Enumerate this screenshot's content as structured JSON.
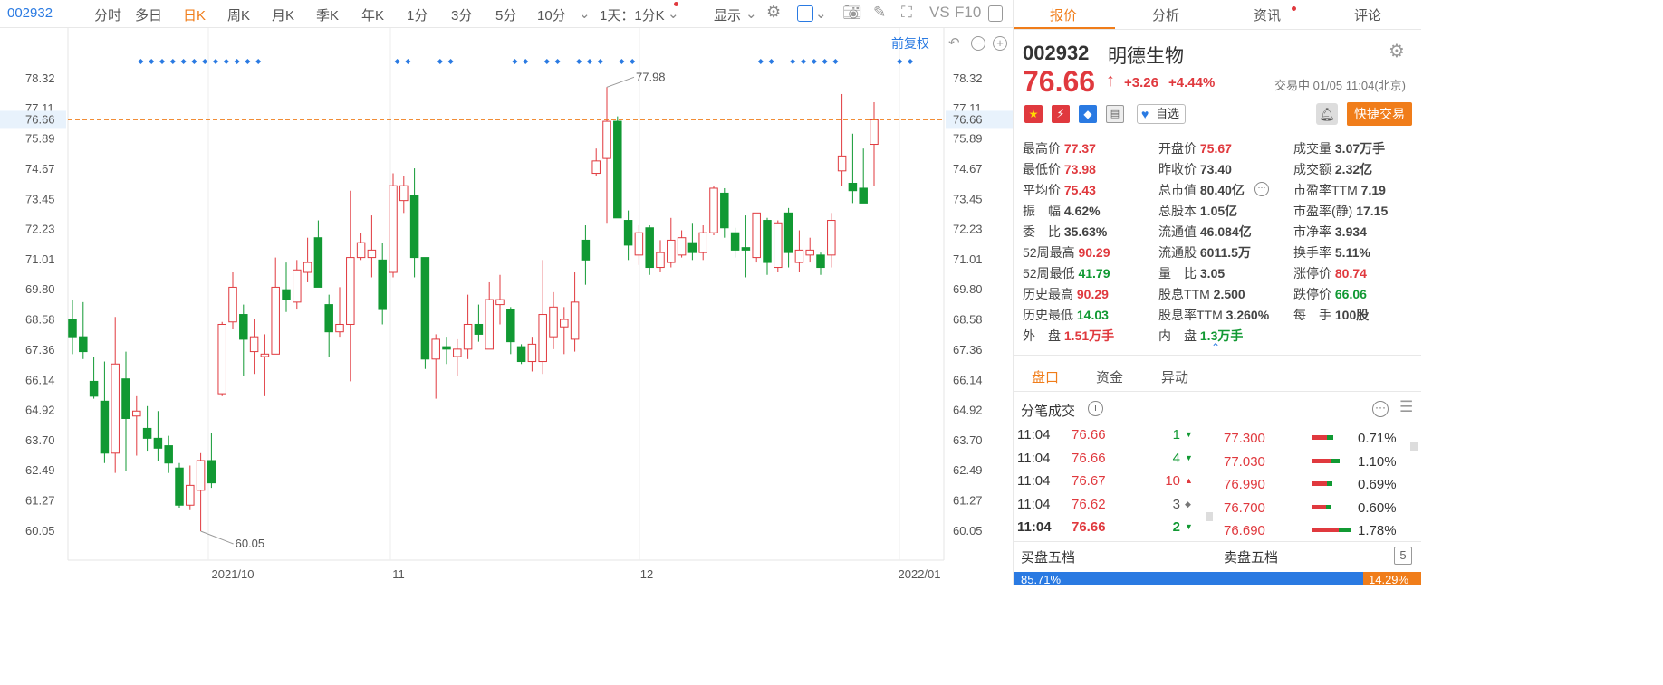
{
  "toolbar": {
    "code": "002932",
    "items": [
      "分时",
      "多日",
      "日K",
      "周K",
      "月K",
      "季K",
      "年K",
      "1分",
      "3分",
      "5分",
      "10分"
    ],
    "active": "日K",
    "range": "1天：1分K",
    "display": "显示",
    "vs": "VS",
    "f10": "F10"
  },
  "chart_header": {
    "adjust": "前复权"
  },
  "chart_data": {
    "type": "candlestick",
    "y_ticks": [
      "78.32",
      "77.11",
      "76.66",
      "75.89",
      "74.67",
      "73.45",
      "72.23",
      "71.01",
      "69.80",
      "68.58",
      "67.36",
      "66.14",
      "64.92",
      "63.70",
      "62.49",
      "61.27",
      "60.05"
    ],
    "ylim": [
      60.05,
      78.32
    ],
    "x_ticks": [
      "2021/10",
      "11",
      "12",
      "2022/01"
    ],
    "current_price": 76.66,
    "max_label": "77.98",
    "min_label": "60.05",
    "candles": [
      {
        "o": 68.6,
        "c": 67.9,
        "h": 69.4,
        "l": 67.2
      },
      {
        "o": 67.9,
        "c": 67.3,
        "h": 69.3,
        "l": 67.0
      },
      {
        "o": 66.1,
        "c": 65.5,
        "h": 67.1,
        "l": 65.4
      },
      {
        "o": 65.3,
        "c": 63.2,
        "h": 66.9,
        "l": 62.8
      },
      {
        "o": 63.2,
        "c": 66.8,
        "h": 68.7,
        "l": 62.4
      },
      {
        "o": 66.2,
        "c": 64.6,
        "h": 67.3,
        "l": 62.5
      },
      {
        "o": 64.7,
        "c": 64.9,
        "h": 65.5,
        "l": 63.1
      },
      {
        "o": 64.2,
        "c": 63.8,
        "h": 65.1,
        "l": 63.3
      },
      {
        "o": 63.8,
        "c": 63.4,
        "h": 64.9,
        "l": 62.9
      },
      {
        "o": 63.5,
        "c": 62.8,
        "h": 63.9,
        "l": 62.4
      },
      {
        "o": 62.6,
        "c": 61.1,
        "h": 62.8,
        "l": 61.0
      },
      {
        "o": 61.1,
        "c": 61.9,
        "h": 62.7,
        "l": 60.9
      },
      {
        "o": 61.7,
        "c": 62.9,
        "h": 63.2,
        "l": 60.05
      },
      {
        "o": 62.9,
        "c": 62.0,
        "h": 64.0,
        "l": 61.8
      },
      {
        "o": 65.6,
        "c": 68.4,
        "h": 68.5,
        "l": 65.5
      },
      {
        "o": 68.5,
        "c": 69.9,
        "h": 70.5,
        "l": 68.2
      },
      {
        "o": 68.8,
        "c": 67.8,
        "h": 69.2,
        "l": 66.3
      },
      {
        "o": 67.3,
        "c": 67.9,
        "h": 68.6,
        "l": 66.4
      },
      {
        "o": 67.1,
        "c": 67.2,
        "h": 68.0,
        "l": 65.5
      },
      {
        "o": 67.2,
        "c": 69.9,
        "h": 71.1,
        "l": 67.2
      },
      {
        "o": 69.8,
        "c": 69.4,
        "h": 70.9,
        "l": 68.9
      },
      {
        "o": 69.3,
        "c": 70.6,
        "h": 71.0,
        "l": 69.0
      },
      {
        "o": 70.5,
        "c": 70.9,
        "h": 71.9,
        "l": 70.1
      },
      {
        "o": 71.9,
        "c": 69.9,
        "h": 72.6,
        "l": 69.9
      },
      {
        "o": 69.2,
        "c": 68.1,
        "h": 69.6,
        "l": 67.1
      },
      {
        "o": 68.1,
        "c": 68.4,
        "h": 69.9,
        "l": 67.9
      },
      {
        "o": 68.4,
        "c": 71.1,
        "h": 73.8,
        "l": 66.1
      },
      {
        "o": 71.1,
        "c": 71.7,
        "h": 72.1,
        "l": 71.0
      },
      {
        "o": 71.1,
        "c": 71.4,
        "h": 72.8,
        "l": 70.3
      },
      {
        "o": 71.0,
        "c": 69.0,
        "h": 71.7,
        "l": 68.4
      },
      {
        "o": 70.5,
        "c": 74.0,
        "h": 74.5,
        "l": 70.3
      },
      {
        "o": 73.4,
        "c": 74.0,
        "h": 74.4,
        "l": 72.9
      },
      {
        "o": 73.6,
        "c": 71.1,
        "h": 74.7,
        "l": 70.3
      },
      {
        "o": 71.1,
        "c": 67.0,
        "h": 71.1,
        "l": 66.6
      },
      {
        "o": 67.0,
        "c": 67.8,
        "h": 68.0,
        "l": 65.4
      },
      {
        "o": 67.5,
        "c": 67.4,
        "h": 67.9,
        "l": 66.8
      },
      {
        "o": 67.1,
        "c": 67.4,
        "h": 67.8,
        "l": 66.3
      },
      {
        "o": 67.4,
        "c": 68.4,
        "h": 69.6,
        "l": 67.0
      },
      {
        "o": 68.4,
        "c": 68.0,
        "h": 69.2,
        "l": 67.7
      },
      {
        "o": 67.4,
        "c": 69.4,
        "h": 70.1,
        "l": 67.4
      },
      {
        "o": 69.2,
        "c": 69.4,
        "h": 70.4,
        "l": 68.4
      },
      {
        "o": 69.0,
        "c": 67.7,
        "h": 69.1,
        "l": 67.2
      },
      {
        "o": 67.5,
        "c": 66.9,
        "h": 67.6,
        "l": 66.8
      },
      {
        "o": 66.9,
        "c": 67.6,
        "h": 67.9,
        "l": 66.5
      },
      {
        "o": 66.9,
        "c": 68.8,
        "h": 71.0,
        "l": 66.4
      },
      {
        "o": 67.9,
        "c": 69.1,
        "h": 69.7,
        "l": 67.4
      },
      {
        "o": 68.3,
        "c": 68.6,
        "h": 69.1,
        "l": 67.2
      },
      {
        "o": 67.8,
        "c": 69.3,
        "h": 70.5,
        "l": 67.3
      },
      {
        "o": 71.8,
        "c": 71.0,
        "h": 72.4,
        "l": 70.0
      },
      {
        "o": 74.5,
        "c": 75.0,
        "h": 75.5,
        "l": 74.4
      },
      {
        "o": 75.1,
        "c": 76.6,
        "h": 77.98,
        "l": 72.5
      },
      {
        "o": 76.6,
        "c": 72.7,
        "h": 76.8,
        "l": 72.7
      },
      {
        "o": 72.6,
        "c": 71.6,
        "h": 73.0,
        "l": 71.0
      },
      {
        "o": 71.2,
        "c": 72.1,
        "h": 72.4,
        "l": 70.8
      },
      {
        "o": 72.3,
        "c": 70.7,
        "h": 72.4,
        "l": 70.4
      },
      {
        "o": 70.7,
        "c": 71.3,
        "h": 71.8,
        "l": 70.5
      },
      {
        "o": 70.9,
        "c": 71.8,
        "h": 72.7,
        "l": 70.7
      },
      {
        "o": 71.2,
        "c": 71.9,
        "h": 72.2,
        "l": 71.1
      },
      {
        "o": 71.7,
        "c": 71.3,
        "h": 72.5,
        "l": 71.0
      },
      {
        "o": 71.3,
        "c": 72.1,
        "h": 72.4,
        "l": 71.0
      },
      {
        "o": 72.1,
        "c": 73.9,
        "h": 74.0,
        "l": 72.0
      },
      {
        "o": 73.7,
        "c": 72.3,
        "h": 73.9,
        "l": 71.9
      },
      {
        "o": 72.1,
        "c": 71.4,
        "h": 72.3,
        "l": 71.1
      },
      {
        "o": 71.5,
        "c": 71.4,
        "h": 72.8,
        "l": 70.3
      },
      {
        "o": 71.1,
        "c": 72.9,
        "h": 72.9,
        "l": 70.9
      },
      {
        "o": 72.6,
        "c": 70.9,
        "h": 72.7,
        "l": 70.4
      },
      {
        "o": 70.7,
        "c": 72.5,
        "h": 72.6,
        "l": 70.5
      },
      {
        "o": 72.9,
        "c": 71.3,
        "h": 73.1,
        "l": 70.7
      },
      {
        "o": 70.9,
        "c": 71.4,
        "h": 72.2,
        "l": 70.5
      },
      {
        "o": 71.2,
        "c": 71.4,
        "h": 71.9,
        "l": 70.9
      },
      {
        "o": 71.2,
        "c": 70.7,
        "h": 71.3,
        "l": 70.4
      },
      {
        "o": 71.2,
        "c": 72.6,
        "h": 72.9,
        "l": 70.7
      },
      {
        "o": 74.6,
        "c": 75.2,
        "h": 77.7,
        "l": 74.0
      },
      {
        "o": 74.1,
        "c": 73.8,
        "h": 76.1,
        "l": 73.3
      },
      {
        "o": 73.9,
        "c": 73.3,
        "h": 75.5,
        "l": 73.3
      },
      {
        "o": 75.67,
        "c": 76.66,
        "h": 77.37,
        "l": 73.98
      }
    ]
  },
  "panel": {
    "tabs": [
      "报价",
      "分析",
      "资讯",
      "评论"
    ],
    "active_tab": "报价",
    "code": "002932",
    "name": "明德生物",
    "price": "76.66",
    "arrow": "↑",
    "change": "+3.26",
    "change_pct": "+4.44%",
    "status": "交易中 01/05 11:04(北京)",
    "watch": "自选",
    "trade": "快捷交易",
    "stats": [
      [
        {
          "k": "最高价",
          "v": "77.37",
          "c": "red"
        },
        {
          "k": "开盘价",
          "v": "75.67",
          "c": "red"
        },
        {
          "k": "成交量",
          "v": "3.07万手",
          "c": ""
        }
      ],
      [
        {
          "k": "最低价",
          "v": "73.98",
          "c": "red"
        },
        {
          "k": "昨收价",
          "v": "73.40",
          "c": ""
        },
        {
          "k": "成交额",
          "v": "2.32亿",
          "c": ""
        }
      ],
      [
        {
          "k": "平均价",
          "v": "75.43",
          "c": "red"
        },
        {
          "k": "总市值",
          "v": "80.40亿",
          "c": ""
        },
        {
          "k": "市盈率TTM",
          "v": "7.19",
          "c": ""
        }
      ],
      [
        {
          "k": "振　幅",
          "v": "4.62%",
          "c": ""
        },
        {
          "k": "总股本",
          "v": "1.05亿",
          "c": ""
        },
        {
          "k": "市盈率(静)",
          "v": "17.15",
          "c": ""
        }
      ],
      [
        {
          "k": "委　比",
          "v": "35.63%",
          "c": ""
        },
        {
          "k": "流通值",
          "v": "46.084亿",
          "c": ""
        },
        {
          "k": "市净率",
          "v": "3.934",
          "c": ""
        }
      ],
      [
        {
          "k": "52周最高",
          "v": "90.29",
          "c": "red"
        },
        {
          "k": "流通股",
          "v": "6011.5万",
          "c": ""
        },
        {
          "k": "换手率",
          "v": "5.11%",
          "c": ""
        }
      ],
      [
        {
          "k": "52周最低",
          "v": "41.79",
          "c": "green"
        },
        {
          "k": "量　比",
          "v": "3.05",
          "c": ""
        },
        {
          "k": "涨停价",
          "v": "80.74",
          "c": "red"
        }
      ],
      [
        {
          "k": "历史最高",
          "v": "90.29",
          "c": "red"
        },
        {
          "k": "股息TTM",
          "v": "2.500",
          "c": ""
        },
        {
          "k": "跌停价",
          "v": "66.06",
          "c": "green"
        }
      ],
      [
        {
          "k": "历史最低",
          "v": "14.03",
          "c": "green"
        },
        {
          "k": "股息率TTM",
          "v": "3.260%",
          "c": ""
        },
        {
          "k": "每　手",
          "v": "100股",
          "c": ""
        }
      ],
      [
        {
          "k": "外　盘",
          "v": "1.51万手",
          "c": "red"
        },
        {
          "k": "内　盘",
          "v": "1.3万手",
          "c": "green"
        }
      ]
    ],
    "sub_tabs": [
      "盘口",
      "资金",
      "异动"
    ],
    "active_sub_tab": "盘口",
    "trades_title": "分笔成交",
    "trades": [
      {
        "time": "11:04",
        "price": "76.66",
        "vol": "1",
        "dir": "down"
      },
      {
        "time": "11:04",
        "price": "76.66",
        "vol": "4",
        "dir": "down"
      },
      {
        "time": "11:04",
        "price": "76.67",
        "vol": "10",
        "dir": "up"
      },
      {
        "time": "11:04",
        "price": "76.62",
        "vol": "3",
        "dir": "flat"
      },
      {
        "time": "11:04",
        "price": "76.66",
        "vol": "2",
        "dir": "down"
      }
    ],
    "levels": [
      {
        "price": "77.300",
        "pct": "0.71%",
        "ratio": 0.71
      },
      {
        "price": "77.030",
        "pct": "1.10%",
        "ratio": 1.1
      },
      {
        "price": "76.990",
        "pct": "0.69%",
        "ratio": 0.69
      },
      {
        "price": "76.700",
        "pct": "0.60%",
        "ratio": 0.6
      },
      {
        "price": "76.690",
        "pct": "1.78%",
        "ratio": 1.78
      }
    ],
    "buy_title": "买盘五档",
    "sell_title": "卖盘五档",
    "buy_ratio": "85.71%",
    "sell_ratio": "14.29%"
  }
}
